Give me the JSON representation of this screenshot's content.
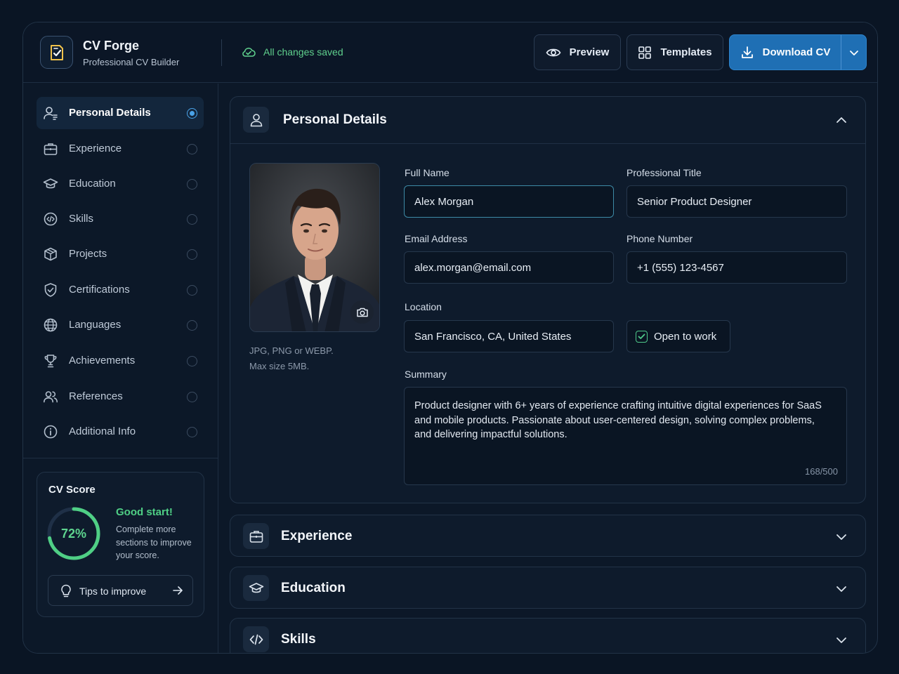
{
  "header": {
    "brand_name": "CV Forge",
    "brand_sub": "Professional CV Builder",
    "save_status": "All changes saved",
    "preview_label": "Preview",
    "templates_label": "Templates",
    "download_label": "Download CV"
  },
  "sidebar": {
    "items": [
      {
        "label": "Personal Details",
        "icon": "user-icon",
        "active": true
      },
      {
        "label": "Experience",
        "icon": "briefcase-icon",
        "active": false
      },
      {
        "label": "Education",
        "icon": "graduation-cap-icon",
        "active": false
      },
      {
        "label": "Skills",
        "icon": "code-icon",
        "active": false
      },
      {
        "label": "Projects",
        "icon": "box-icon",
        "active": false
      },
      {
        "label": "Certifications",
        "icon": "shield-check-icon",
        "active": false
      },
      {
        "label": "Languages",
        "icon": "globe-icon",
        "active": false
      },
      {
        "label": "Achievements",
        "icon": "trophy-icon",
        "active": false
      },
      {
        "label": "References",
        "icon": "users-icon",
        "active": false
      },
      {
        "label": "Additional Info",
        "icon": "info-icon",
        "active": false
      }
    ]
  },
  "score": {
    "title": "CV Score",
    "percent_label": "72%",
    "percent_value": 0.72,
    "headline": "Good start!",
    "message": "Complete more sections to improve your score.",
    "tips_label": "Tips to improve"
  },
  "personal": {
    "title": "Personal Details",
    "photo_note_1": "JPG, PNG or WEBP.",
    "photo_note_2": "Max size 5MB.",
    "full_name_label": "Full Name",
    "full_name": "Alex Morgan",
    "title_label": "Professional Title",
    "title_value": "Senior Product Designer",
    "email_label": "Email Address",
    "email": "alex.morgan@email.com",
    "phone_label": "Phone Number",
    "phone": "+1 (555) 123-4567",
    "location_label": "Location",
    "location": "San Francisco, CA, United States",
    "open_to_work_label": "Open to work",
    "open_to_work": true,
    "summary_label": "Summary",
    "summary": "Product designer with 6+ years of experience crafting intuitive digital experiences for SaaS and mobile products. Passionate about user-centered design, solving complex problems, and delivering impactful solutions.",
    "summary_count": "168/500"
  },
  "sections": [
    {
      "title": "Experience",
      "icon": "briefcase-icon"
    },
    {
      "title": "Education",
      "icon": "graduation-cap-icon"
    },
    {
      "title": "Skills",
      "icon": "code-icon"
    }
  ],
  "colors": {
    "accent_blue": "#1f6fb4",
    "success_green": "#4fcf85",
    "background": "#0a1524"
  }
}
